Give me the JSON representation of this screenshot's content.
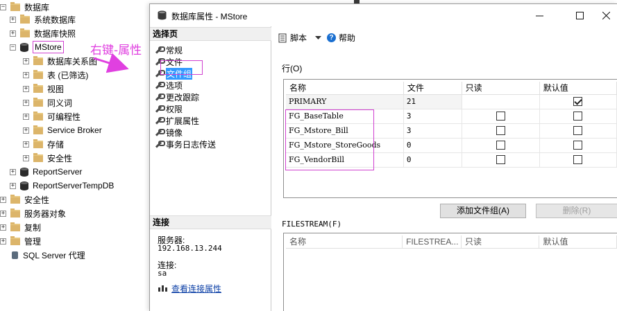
{
  "explorer": {
    "rows": [
      {
        "label": "数据库",
        "level": 0,
        "exp": "⊟",
        "icon": "folder"
      },
      {
        "label": "系统数据库",
        "level": 1,
        "exp": "+",
        "icon": "folder"
      },
      {
        "label": "数据库快照",
        "level": 1,
        "exp": "+",
        "icon": "folder"
      },
      {
        "label": "MStore",
        "level": 1,
        "exp": "−",
        "icon": "database"
      },
      {
        "label": "数据库关系图",
        "level": 2,
        "exp": "+",
        "icon": "folder"
      },
      {
        "label": "表 (已筛选)",
        "level": 2,
        "exp": "+",
        "icon": "folder"
      },
      {
        "label": "视图",
        "level": 2,
        "exp": "+",
        "icon": "folder"
      },
      {
        "label": "同义词",
        "level": 2,
        "exp": "+",
        "icon": "folder"
      },
      {
        "label": "可编程性",
        "level": 2,
        "exp": "+",
        "icon": "folder"
      },
      {
        "label": "Service Broker",
        "level": 2,
        "exp": "+",
        "icon": "folder"
      },
      {
        "label": "存储",
        "level": 2,
        "exp": "+",
        "icon": "folder"
      },
      {
        "label": "安全性",
        "level": 2,
        "exp": "+",
        "icon": "folder"
      },
      {
        "label": "ReportServer",
        "level": 1,
        "exp": "+",
        "icon": "database"
      },
      {
        "label": "ReportServerTempDB",
        "level": 1,
        "exp": "+",
        "icon": "database"
      },
      {
        "label": "安全性",
        "level": 0,
        "exp": "+",
        "icon": "folder"
      },
      {
        "label": "服务器对象",
        "level": 0,
        "exp": "+",
        "icon": "folder"
      },
      {
        "label": "复制",
        "level": 0,
        "exp": "+",
        "icon": "folder"
      },
      {
        "label": "管理",
        "level": 0,
        "exp": "+",
        "icon": "folder"
      },
      {
        "label": "SQL Server 代理",
        "level": 0,
        "exp": "",
        "icon": "agent"
      }
    ]
  },
  "annotation": {
    "text": "右键-属性",
    "color": "#e040e0"
  },
  "dialog": {
    "title": "数据库属性 - MStore",
    "select_page_header": "选择页",
    "pages": [
      "常规",
      "文件",
      "文件组",
      "选项",
      "更改跟踪",
      "权限",
      "扩展属性",
      "镜像",
      "事务日志传送"
    ],
    "selected_page": "文件组",
    "connection_header": "连接",
    "server_label": "服务器:",
    "server_value": "192.168.13.244",
    "conn_label": "连接:",
    "conn_value": "sa",
    "conn_link": "查看连接属性",
    "toolbar": {
      "script_label": "脚本",
      "help_label": "帮助"
    },
    "rows_label": "行(O)",
    "filegroup_grid": {
      "columns": [
        "名称",
        "文件",
        "只读",
        "默认值"
      ],
      "rows": [
        {
          "name": "PRIMARY",
          "files": "21",
          "readonly": null,
          "default": true
        },
        {
          "name": "FG_BaseTable",
          "files": "3",
          "readonly": false,
          "default": false
        },
        {
          "name": "FG_Mstore_Bill",
          "files": "3",
          "readonly": false,
          "default": false
        },
        {
          "name": "FG_Mstore_StoreGoods",
          "files": "0",
          "readonly": false,
          "default": false
        },
        {
          "name": "FG_VendorBill",
          "files": "0",
          "readonly": false,
          "default": false
        }
      ]
    },
    "add_filegroup_button": "添加文件组(A)",
    "remove_button": "删除(R)",
    "filestream_label": "FILESTREAM(F)",
    "filestream_grid": {
      "columns": [
        "名称",
        "FILESTREA...",
        "只读",
        "默认值"
      ]
    }
  },
  "colors": {
    "highlight": "#d040d0",
    "selection": "#3399ff",
    "link": "#0b3fa6"
  }
}
